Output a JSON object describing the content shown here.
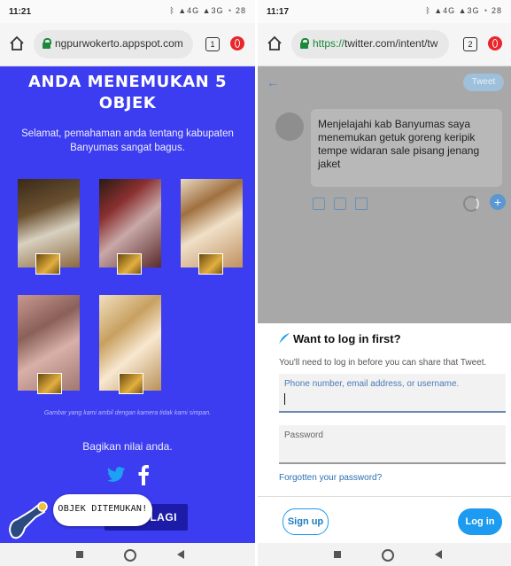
{
  "colors": {
    "page_blue": "#3c3cf0",
    "twitter_blue": "#1d9bf0",
    "opera_red": "#e8262b"
  },
  "left_phone": {
    "status": {
      "time": "11:21",
      "indicators": "ᛒ ▲4G ▲3G ◔ 28"
    },
    "browser": {
      "url": "ngpurwokerto.appspot.com",
      "tabs_count": "1"
    },
    "page": {
      "title": "ANDA MENEMUKAN 5 OBJEK",
      "congrats": "Selamat, pemahaman anda tentang kabupaten Banyumas sangat bagus.",
      "photos": [
        "photo-1",
        "photo-2",
        "photo-3",
        "photo-4",
        "photo-5"
      ],
      "caption": "Gambar yang kami ambil dengan kamera tidak kami simpan.",
      "share_prompt": "Bagikan nilai anda.",
      "share_icons": [
        "twitter-icon",
        "facebook-icon"
      ],
      "bottom_button": "LAGI",
      "toast": "OBJEK DITEMUKAN!"
    }
  },
  "right_phone": {
    "status": {
      "time": "11:17",
      "indicators": "ᛒ ▲4G ▲3G ◔ 28"
    },
    "browser": {
      "url_secure": "https://",
      "url_rest": "twitter.com/intent/tw",
      "tabs_count": "2"
    },
    "composer": {
      "back_icon": "back-arrow-icon",
      "tweet_button": "Tweet",
      "tweet_text": "Menjelajahi kab Banyumas saya menemukan getuk goreng keripik tempe widaran sale pisang jenang jaket"
    },
    "login": {
      "title": "Want to log in first?",
      "subtitle": "You'll need to log in before you can share that Tweet.",
      "username_placeholder": "Phone number, email address, or username.",
      "password_placeholder": "Password",
      "forgot_link": "Forgotten your password?",
      "signup_button": "Sign up",
      "login_button": "Log in"
    }
  }
}
